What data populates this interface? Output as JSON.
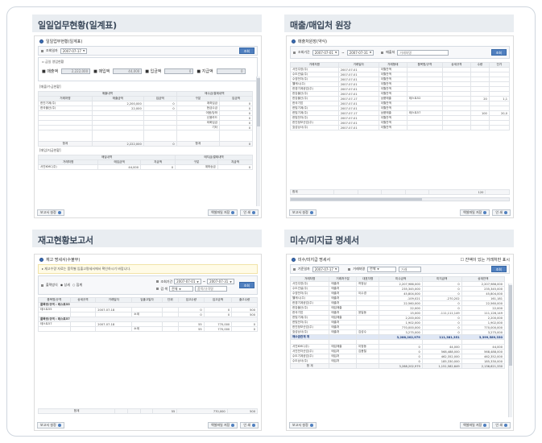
{
  "q1": {
    "title": "일일업무현황(일계표)",
    "win_title": "일일업무현황(일계표)",
    "filter_label": "조회일자",
    "date": "2007-07-17",
    "search_btn": "조회",
    "summary_label": "금일 영업현황",
    "summary": [
      {
        "label": "매출액",
        "value": "2,222,000"
      },
      {
        "label": "매입액",
        "value": "44,000"
      },
      {
        "label": "입금액",
        "value": "0"
      },
      {
        "label": "지급액",
        "value": "0"
      }
    ],
    "sec1": "[매출/수금현황]",
    "sec1_head1": "매출내역",
    "sec1_head2": "매수금/결제내역",
    "sec1_cols": [
      "거래처명",
      "매출금액",
      "입금액",
      "구분",
      "입금액"
    ],
    "sec1_rows": [
      [
        "한진기계(주)",
        "2,200,000",
        "0",
        "계좌입금",
        "0"
      ],
      [
        "한국물산(주)",
        "22,000",
        "0",
        "현금수금",
        "0"
      ],
      [
        "",
        "",
        "",
        "어음/당좌",
        "0"
      ],
      [
        "",
        "",
        "",
        "신용카드",
        "0"
      ],
      [
        "",
        "",
        "",
        "외화입금",
        "0"
      ],
      [
        "",
        "",
        "",
        "기타",
        "0"
      ]
    ],
    "sec1_total": [
      "합계",
      "2,222,000",
      "0",
      "합계",
      "0"
    ],
    "sec2": "[매입/지급현황]",
    "sec2_head1": "매입내역",
    "sec2_head2": "매지급/결제내역",
    "sec2_cols": [
      "거래처명",
      "매입금액",
      "지급액",
      "구분",
      "지급액"
    ],
    "sec2_rows": [
      [
        "서진KMC(주)",
        "44,000",
        "0",
        "계좌송금",
        "0"
      ]
    ],
    "foot_left": "보고서 설정",
    "foot_excel": "엑셀파일 저장",
    "foot_print": "인 쇄"
  },
  "q2": {
    "title": "매출/매입처 원장",
    "win_title": "매출처원장(약식)",
    "filter_label": "조회기간",
    "date_from": "2007-07-01",
    "date_to": "2007-07-31",
    "partner_label": "매출처",
    "partner_value": "거래처명",
    "search_btn": "조회",
    "cols": [
      "거래처명",
      "거래일자",
      "거래형태",
      "품목명/규격",
      "상세규격",
      "수량",
      "단가"
    ],
    "rows": [
      [
        "서진주방(주)",
        "2007-07-01",
        "이월잔액",
        "",
        "",
        "",
        ""
      ],
      [
        "수도건설(주)",
        "2007-07-01",
        "이월잔액",
        "",
        "",
        "",
        ""
      ],
      [
        "수영전자(주)",
        "2007-07-01",
        "이월잔액",
        "",
        "",
        "",
        ""
      ],
      [
        "웰캐시(주)",
        "2007-07-01",
        "이월잔액",
        "",
        "",
        "",
        ""
      ],
      [
        "한경기계공업(주)",
        "2007-07-01",
        "이월잔액",
        "",
        "",
        "",
        ""
      ],
      [
        "한강물산(주)",
        "2007-07-01",
        "이월잔액",
        "",
        "",
        "",
        ""
      ],
      [
        "한강물산(주)",
        "2007-07-17",
        "상품매출",
        "테스트52",
        "",
        "20",
        "1,1"
      ],
      [
        "한국기업",
        "2007-07-01",
        "이월잔액",
        "",
        "",
        "",
        ""
      ],
      [
        "한빛기계(주)",
        "2007-07-01",
        "이월잔액",
        "",
        "",
        "",
        ""
      ],
      [
        "한빛기계(주)",
        "2007-07-17",
        "상품매출",
        "테스트57",
        "",
        "100",
        "20,0"
      ],
      [
        "한빛전자(주)",
        "2007-07-01",
        "이월잔액",
        "",
        "",
        "",
        ""
      ],
      [
        "한진정보산업(주)",
        "2007-07-01",
        "이월잔액",
        "",
        "",
        "",
        ""
      ],
      [
        "효성상사(주)",
        "2007-07-01",
        "이월잔액",
        "",
        "",
        "",
        ""
      ]
    ],
    "total": [
      "합계",
      "",
      "",
      "",
      "",
      "120",
      ""
    ],
    "foot_left": "보고서 설정",
    "foot_excel": "엑셀파일 저장",
    "foot_print": "인 쇄"
  },
  "q3": {
    "title": "재고현황보고서",
    "win_title": "재고 명세서(수불부)",
    "note": "재고수량 자료는 품목별 입출고명세서에서 확인하시기 바랍니다.",
    "radio_label": "출력방식",
    "radio1": "상세",
    "radio2": "집계",
    "period_label": "조회기간",
    "date_from": "2007-07-01",
    "date_to": "2007-07-31",
    "search_label": "검 색",
    "search_sel": "전체",
    "search_input": "품목/규격명",
    "search_btn": "조회",
    "cols": [
      "품목명/규격",
      "상세규격",
      "거래일자",
      "입출고일자",
      "단위",
      "입고수량",
      "입고금액",
      "출고수량"
    ],
    "groups": [
      {
        "name": "품목명/규격 : 테스트55",
        "rows": [
          [
            "테스트55",
            "",
            "2007-07-18",
            "",
            "",
            "0",
            "0",
            "500"
          ],
          [
            "",
            "",
            "",
            "소계",
            "",
            "0",
            "0",
            "500"
          ]
        ]
      },
      {
        "name": "품목명/규격 : 테스트57",
        "rows": [
          [
            "테스트57",
            "",
            "2007-07-18",
            "",
            "",
            "55",
            "770,000",
            "0"
          ],
          [
            "",
            "",
            "",
            "소계",
            "",
            "55",
            "770,000",
            "0"
          ]
        ]
      }
    ],
    "total": [
      "합계",
      "",
      "",
      "",
      "",
      "55",
      "770,000",
      "500"
    ],
    "foot_left": "보고서 설정",
    "foot_excel": "엑셀파일 저장",
    "foot_print": "인 쇄"
  },
  "q4": {
    "title": "미수/미지급 명세서",
    "win_title": "미수/미지급 명세서",
    "checkbox": "잔액이 있는 거래처만 표시",
    "filter_label": "기준일자",
    "date": "2007-07-17",
    "partner_label": "거래처명",
    "partner_sel": "전체",
    "partner_input": "거래",
    "search_btn": "조회",
    "cols": [
      "거래처명",
      "거래처구분",
      "대표자명",
      "미수금액",
      "미지급액",
      "상계잔액"
    ],
    "rows": [
      [
        "서진주방(주)",
        "매출처",
        "허정삼",
        "2,207,986,000",
        "0",
        "2,207,986,000"
      ],
      [
        "수도건설(주)",
        "매출처",
        "",
        "235,345,000",
        "0",
        "235,345,000"
      ],
      [
        "수영전자(주)",
        "매출처",
        "이수경",
        "45,804,000",
        "0",
        "45,804,000"
      ],
      [
        "웰캐시(주)",
        "매출처",
        "",
        "-109,021",
        "-270,202",
        "161,181"
      ],
      [
        "한경기계공업(주)",
        "매출처",
        "",
        "22,560,000",
        "0",
        "22,560,000"
      ],
      [
        "한강물산(주)",
        "매입매출",
        "",
        "22,000",
        "0",
        "22,000"
      ],
      [
        "한국기업",
        "매출처",
        "윤일동",
        "15,000",
        "-111,111,149",
        "111,126,149"
      ],
      [
        "한빛기계(주)",
        "매입매출",
        "",
        "2,200,000",
        "0",
        "2,200,000"
      ],
      [
        "한빛전자(주)",
        "매출처",
        "",
        "1,902,000",
        "0",
        "1,902,000"
      ],
      [
        "한진정보산업(주)",
        "매출처",
        "",
        "770,000,000",
        "0",
        "770,000,000"
      ],
      [
        "효성상사(주)",
        "매출처",
        "김성수",
        "3,275,000",
        "0",
        "3,275,000"
      ]
    ],
    "subtotal": [
      "매수금관계 계",
      "",
      "",
      "3,288,202,979",
      "111,381,351",
      "3,399,589,330"
    ],
    "rows2": [
      [
        "서진KMC(주)",
        "매입매출",
        "이정동",
        "0",
        "44,000",
        "44,000"
      ],
      [
        "서진전자산업(주)",
        "매입처",
        "김용철",
        "0",
        "568,488,000",
        "568,488,000"
      ],
      [
        "수도기계공업(주)",
        "매입처",
        "",
        "0",
        "462,352,000",
        "462,352,000"
      ],
      [
        "수도상사(주)",
        "매입처",
        "",
        "0",
        "185,330,000",
        "185,330,000"
      ]
    ],
    "total": [
      "합 계",
      "",
      "",
      "3,288,202,979",
      "1,151,582,649",
      "2,136,621,330"
    ],
    "foot_left": "보고서 설정",
    "foot_excel": "엑셀파일 저장",
    "foot_print": "인 쇄"
  }
}
